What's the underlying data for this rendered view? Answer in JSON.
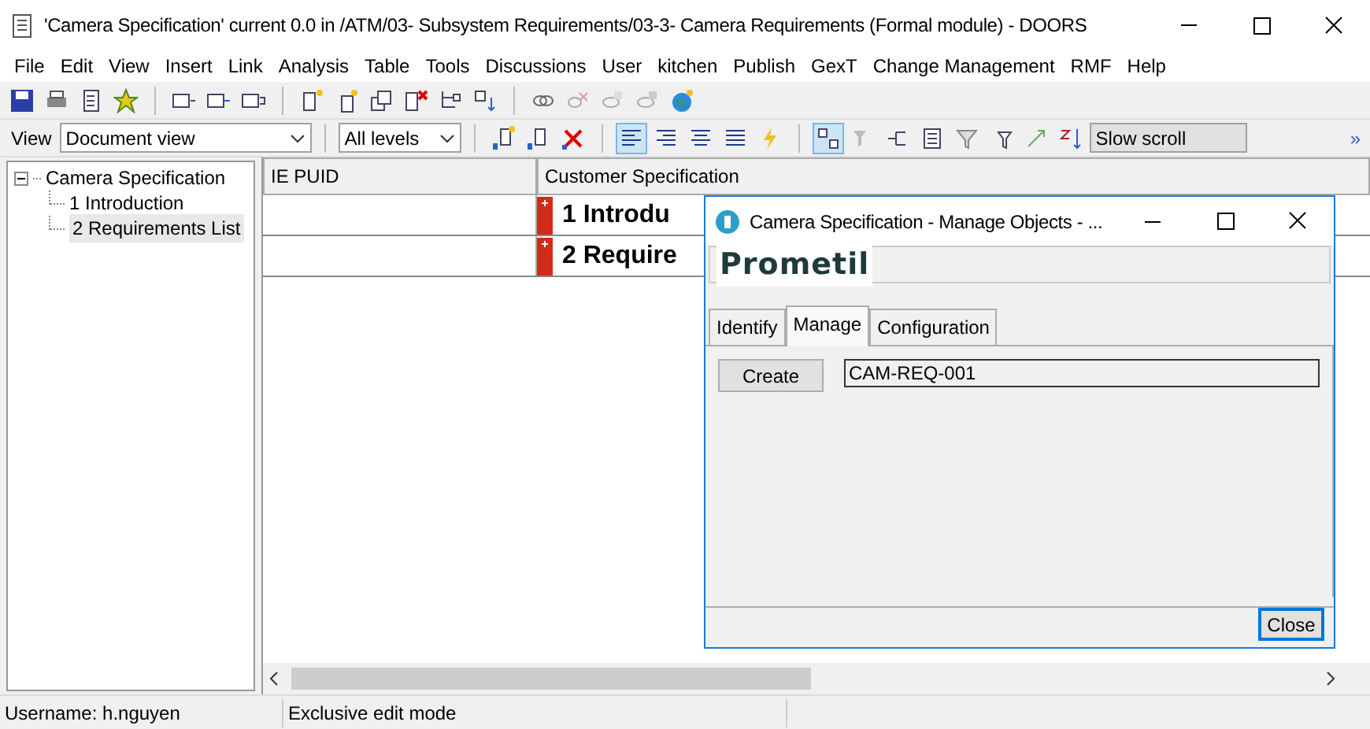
{
  "window": {
    "title": "'Camera Specification' current 0.0 in /ATM/03- Subsystem Requirements/03-3- Camera Requirements (Formal module) - DOORS"
  },
  "menu": [
    "File",
    "Edit",
    "View",
    "Insert",
    "Link",
    "Analysis",
    "Table",
    "Tools",
    "Discussions",
    "User",
    "kitchen",
    "Publish",
    "GexT",
    "Change Management",
    "RMF",
    "Help"
  ],
  "view_bar": {
    "label": "View",
    "view": "Document view",
    "levels": "All levels",
    "scroll": "Slow scroll",
    "overflow": "»"
  },
  "tree": {
    "label": "Camera Specification",
    "expanded": true,
    "selected": false,
    "children": [
      {
        "label": "1 Introduction",
        "selected": false
      },
      {
        "label": "2 Requirements List",
        "selected": true
      }
    ]
  },
  "table": {
    "columns": [
      "IE PUID",
      "Customer Specification"
    ],
    "rows": [
      {
        "ie_puid": "",
        "text": "1 Introdu"
      },
      {
        "ie_puid": "",
        "text": "2 Require"
      }
    ]
  },
  "dialog": {
    "title": "Camera Specification - Manage Objects - ...",
    "logo": "Prometil",
    "tabs": [
      {
        "label": "Identify",
        "selected": false
      },
      {
        "label": "Manage",
        "selected": true
      },
      {
        "label": "Configuration",
        "selected": false
      }
    ],
    "create_button": "Create",
    "object_id": "CAM-REQ-001",
    "close_button": "Close"
  },
  "status_bar": [
    "Username: h.nguyen",
    "Exclusive edit mode"
  ]
}
